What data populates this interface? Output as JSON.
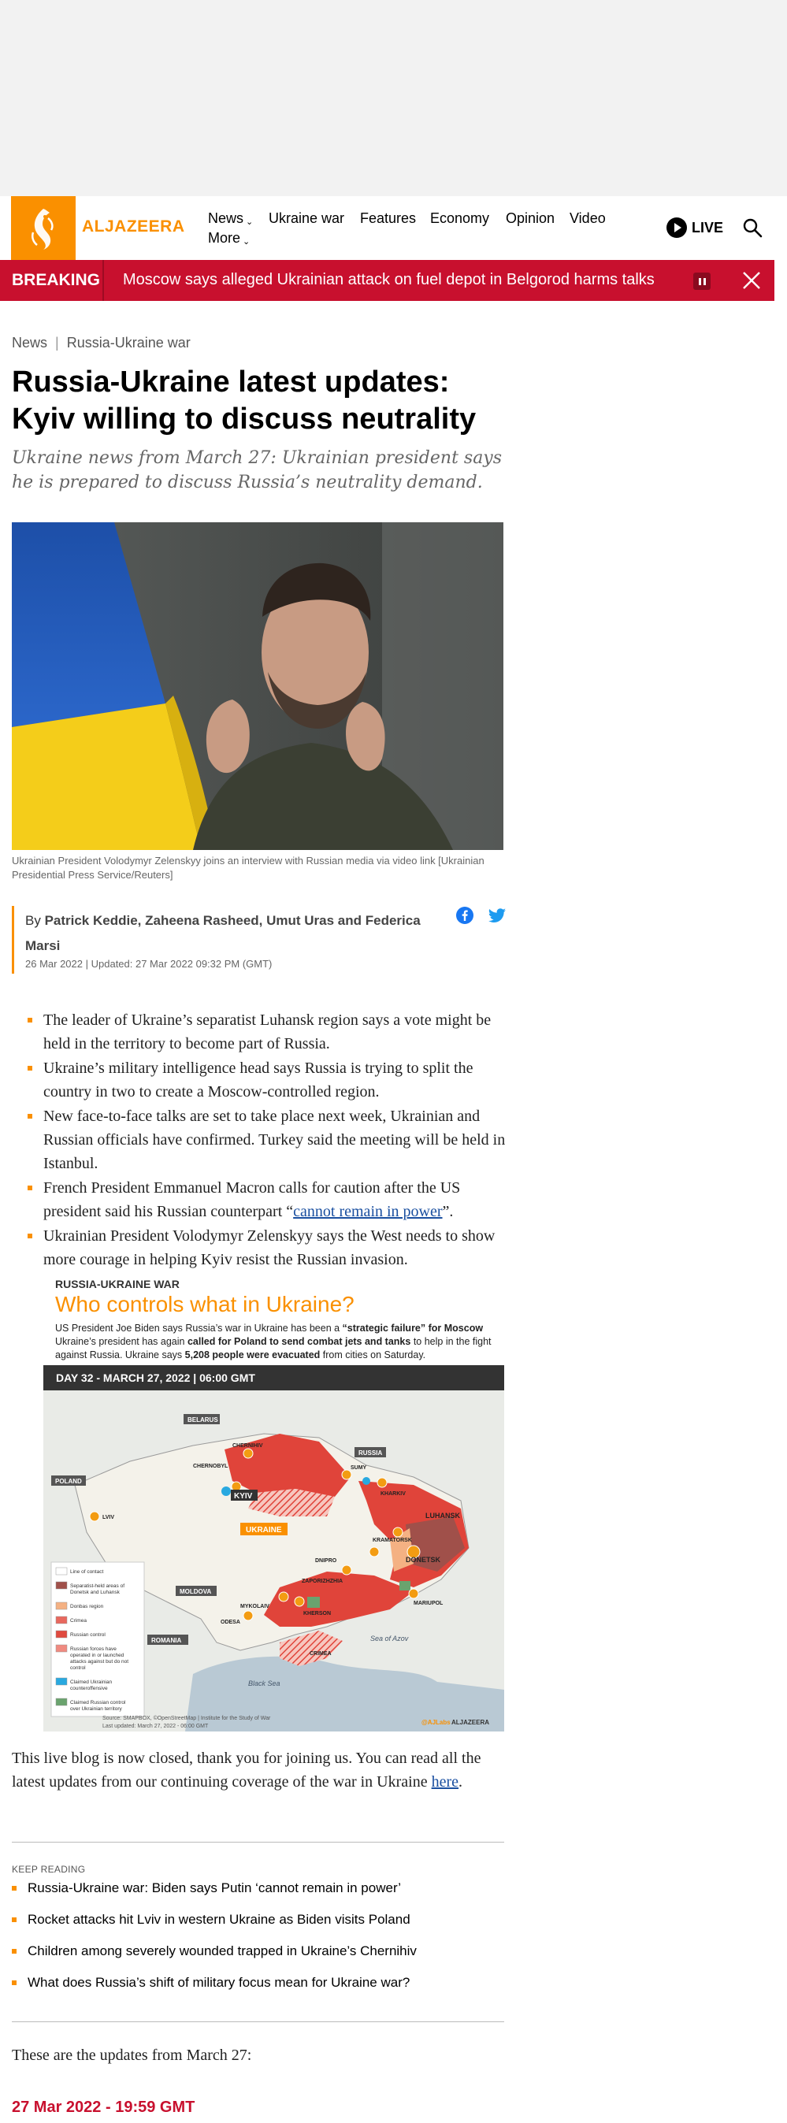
{
  "header": {
    "logo_text": "ALJAZEERA",
    "nav": [
      {
        "label": "News",
        "has_dropdown": true
      },
      {
        "label": "Ukraine war",
        "has_dropdown": false
      },
      {
        "label": "Features",
        "has_dropdown": false
      },
      {
        "label": "Economy",
        "has_dropdown": false
      },
      {
        "label": "Opinion",
        "has_dropdown": false
      },
      {
        "label": "Video",
        "has_dropdown": false
      },
      {
        "label": "More",
        "has_dropdown": true
      }
    ],
    "live_label": "LIVE",
    "icons": [
      "play-icon",
      "search-icon"
    ]
  },
  "breaking": {
    "label": "BREAKING",
    "text": "Moscow says alleged Ukrainian attack on fuel depot in Belgorod harms talks",
    "icons": [
      "pause-icon",
      "close-icon"
    ]
  },
  "article": {
    "breadcrumb": [
      "News",
      "Russia-Ukraine war"
    ],
    "headline": "Russia-Ukraine latest updates: Kyiv willing to discuss neutrality",
    "subheadline": "Ukraine news from March 27: Ukrainian president says he is prepared to discuss Russia’s neutrality demand.",
    "image_caption": "Ukrainian President Volodymyr Zelenskyy joins an interview with Russian media via video link [Ukrainian Presidential Press Service/Reuters]",
    "byline_prefix": "By ",
    "authors": "Patrick Keddie, Zaheena Rasheed, Umut Uras and Federica Marsi",
    "published": "26 Mar 2022",
    "updated": "Updated: 27 Mar 2022 09:32 PM (GMT)",
    "share_icons": [
      "facebook-icon",
      "twitter-icon"
    ],
    "summary": [
      {
        "text": "The leader of Ukraine’s separatist Luhansk region says a vote might be held in the territory to become part of Russia."
      },
      {
        "text": "Ukraine’s military intelligence head says Russia is trying to split the country in two to create a Moscow-controlled region."
      },
      {
        "text": "New face-to-face talks are set to take place next week, Ukrainian and Russian officials have confirmed. Turkey said the meeting will be held in Istanbul."
      },
      {
        "before": "French President Emmanuel Macron calls for caution after the US president said his Russian counterpart “",
        "link": "cannot remain in power",
        "after": "”."
      },
      {
        "text": "Ukrainian President Volodymyr Zelenskyy says the West needs to show more courage in helping Kyiv resist the Russian invasion."
      }
    ],
    "closing_text": "This live blog is now closed, thank you for joining us. You can read all the latest updates from our continuing coverage of the war in Ukraine ",
    "closing_link": "here",
    "closing_end": ".",
    "keep_reading_label": "KEEP READING",
    "keep_reading": [
      "Russia-Ukraine war: Biden says Putin ‘cannot remain in power’",
      "Rocket attacks hit Lviv in western Ukraine as Biden visits Poland",
      "Children among severely wounded trapped in Ukraine’s Chernihiv",
      "What does Russia’s shift of military focus mean for Ukraine war?"
    ],
    "updates_intro": "These are the updates from March 27:",
    "first_update_time": "27 Mar 2022 - 19:59 GMT"
  },
  "map": {
    "kicker": "RUSSIA-UKRAINE WAR",
    "title": "Who controls what in Ukraine?",
    "desc_1": "US President Joe Biden says Russia’s war in Ukraine has been a ",
    "desc_1_bold": "“strategic failure” for Moscow",
    "desc_2": "Ukraine’s president has again ",
    "desc_2_bold": "called for Poland to send combat jets and tanks",
    "desc_3": " to help in the fight against Russia. Ukraine says ",
    "desc_3_bold": "5,208 people were evacuated",
    "desc_4": " from cities on Saturday.",
    "day_bar": "DAY 32  - MARCH 27, 2022  |  06:00 GMT",
    "labels": {
      "belarus": "BELARUS",
      "russia": "RUSSIA",
      "poland": "POLAND",
      "moldova": "MOLDOVA",
      "romania": "ROMANIA",
      "ukraine": "UKRAINE",
      "kyiv": "KYIV",
      "chernihiv": "CHERNIHIV",
      "chernobyl": "CHERNOBYL",
      "sumy": "SUMY",
      "kharkiv": "KHARKIV",
      "lviv": "LVIV",
      "luhansk": "LUHANSK",
      "donetsk": "DONETSK",
      "kramatorsk": "KRAMATORSK",
      "dnipro": "DNIPRO",
      "zaporizhzhia": "ZAPORIZHZHIA",
      "mykolaiv": "MYKOLAIV",
      "kherson": "KHERSON",
      "odesa": "ODESA",
      "mariupol": "MARIUPOL",
      "crimea": "CRIMEA",
      "sea_of_azov": "Sea of Azov",
      "black_sea": "Black Sea"
    },
    "legend": [
      {
        "label": "Line of contact",
        "color": "#ffffff"
      },
      {
        "label": "Separatist-held areas of Donetsk and Luhansk",
        "color": "#a0504a"
      },
      {
        "label": "Donbas region",
        "color": "#f4b183"
      },
      {
        "label": "Crimea",
        "color": "#e8685e"
      },
      {
        "label": "Russian control",
        "color": "#e04a3f"
      },
      {
        "label": "Russian forces have operated in or launched attacks against but do not control",
        "color": "#f08a80"
      },
      {
        "label": "Claimed Ukrainian counteroffensive",
        "color": "#29a9e0"
      },
      {
        "label": "Claimed Russian control over Ukrainian territory",
        "color": "#6aa36e"
      }
    ],
    "source": "Source: SMAPBOX, ©OpenStreetMap  |  Institute for the Study of War",
    "last_updated": "Last updated: March 27, 2022 - 06:00 GMT",
    "brand": "ALJAZEERA",
    "credit": "@AJLabs"
  },
  "colors": {
    "brand_orange": "#fa9000",
    "breaking_red": "#c8102e",
    "link_blue": "#1a4fa0"
  }
}
